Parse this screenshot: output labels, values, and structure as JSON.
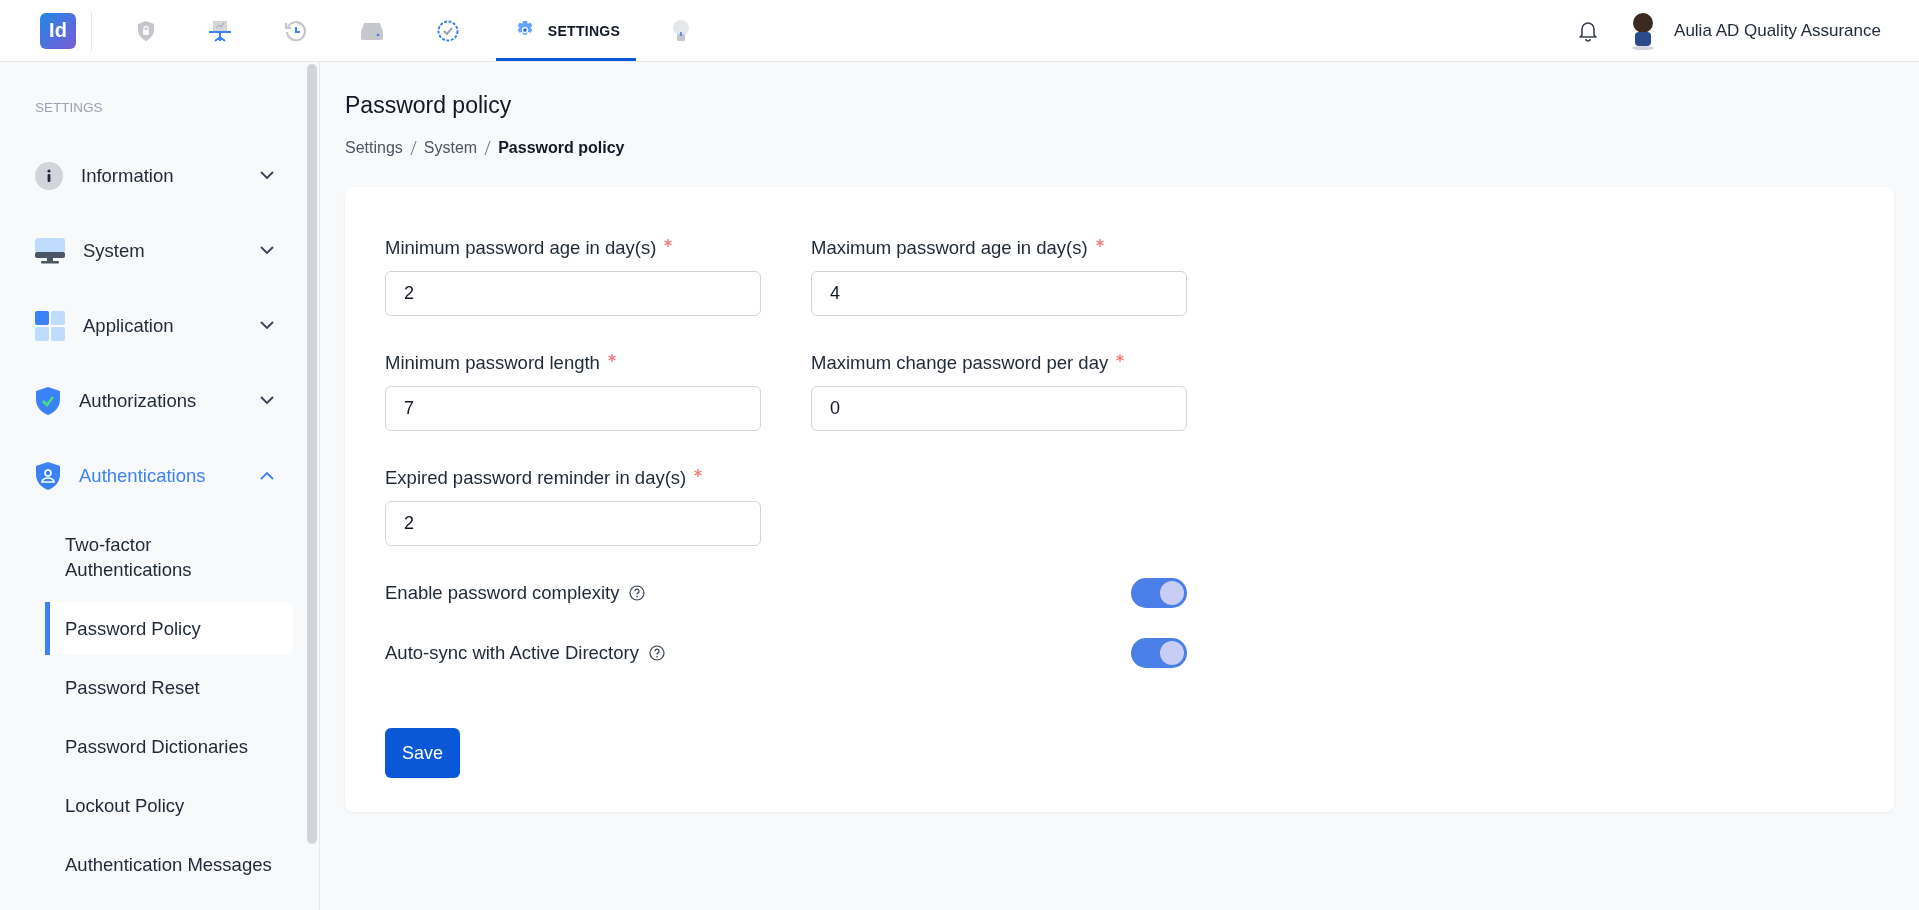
{
  "app_logo": "Id",
  "nav_tabs": [
    {
      "selected": false
    },
    {
      "selected": false
    },
    {
      "selected": false
    },
    {
      "selected": false
    },
    {
      "selected": false
    },
    {
      "label": "SETTINGS",
      "selected": true
    },
    {
      "selected": false
    }
  ],
  "user": {
    "name": "Aulia AD Quality Assurance"
  },
  "sidebar": {
    "heading": "SETTINGS",
    "groups": [
      {
        "label": "Information",
        "expanded": false
      },
      {
        "label": "System",
        "expanded": false
      },
      {
        "label": "Application",
        "expanded": false
      },
      {
        "label": "Authorizations",
        "expanded": false
      },
      {
        "label": "Authentications",
        "expanded": true,
        "children": [
          {
            "label": "Two-factor Authentications",
            "selected": false
          },
          {
            "label": "Password Policy",
            "selected": true
          },
          {
            "label": "Password Reset",
            "selected": false
          },
          {
            "label": "Password Dictionaries",
            "selected": false
          },
          {
            "label": "Lockout Policy",
            "selected": false
          },
          {
            "label": "Authentication Messages",
            "selected": false
          }
        ]
      }
    ]
  },
  "page": {
    "title": "Password policy",
    "breadcrumb": [
      "Settings",
      "System",
      "Password policy"
    ]
  },
  "fields": [
    {
      "label": "Minimum password age in day(s)",
      "required": true,
      "value": "2"
    },
    {
      "label": "Maximum password age in day(s)",
      "required": true,
      "value": "4"
    },
    {
      "label": "Minimum password length",
      "required": true,
      "value": "7"
    },
    {
      "label": "Maximum change password per day",
      "required": true,
      "value": "0"
    },
    {
      "label": "Expired password reminder in day(s)",
      "required": true,
      "value": "2"
    }
  ],
  "toggles": [
    {
      "label": "Enable password complexity",
      "on": true
    },
    {
      "label": "Auto-sync with Active Directory",
      "on": true
    }
  ],
  "save_button": "Save"
}
